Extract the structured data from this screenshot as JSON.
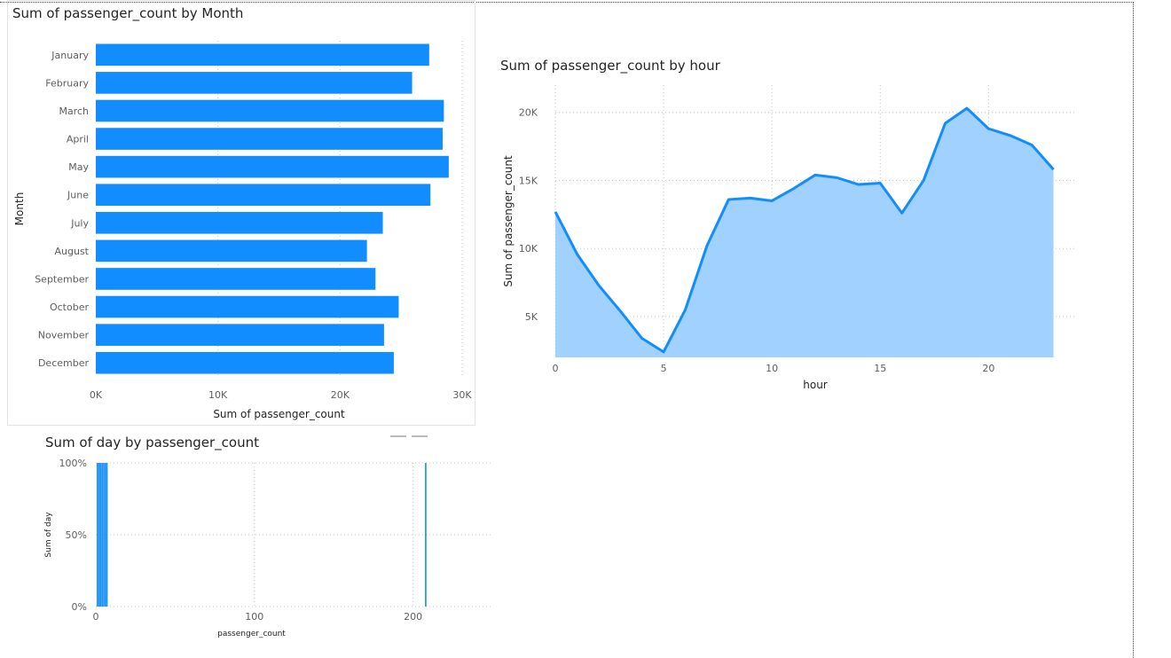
{
  "chart_data": [
    {
      "type": "bar",
      "orientation": "horizontal",
      "title": "Sum of passenger_count by Month",
      "xlabel": "Sum of passenger_count",
      "ylabel": "Month",
      "categories": [
        "January",
        "February",
        "March",
        "April",
        "May",
        "June",
        "July",
        "August",
        "September",
        "October",
        "November",
        "December"
      ],
      "values": [
        27300,
        25900,
        28500,
        28400,
        28900,
        27400,
        23500,
        22200,
        22900,
        24800,
        23600,
        24400
      ],
      "xlim": [
        0,
        30000
      ],
      "xticks": [
        "0K",
        "10K",
        "20K",
        "30K"
      ],
      "color": "#118dff",
      "grid": true
    },
    {
      "type": "area",
      "title": "Sum of passenger_count by hour",
      "xlabel": "hour",
      "ylabel": "Sum of passenger_count",
      "x": [
        0,
        1,
        2,
        3,
        4,
        5,
        6,
        7,
        8,
        9,
        10,
        11,
        12,
        13,
        14,
        15,
        16,
        17,
        18,
        19,
        20,
        21,
        22,
        23
      ],
      "values": [
        12700,
        9600,
        7300,
        5400,
        3400,
        2400,
        5500,
        10200,
        13600,
        13700,
        13500,
        14400,
        15400,
        15200,
        14700,
        14800,
        12600,
        15000,
        19200,
        20300,
        18800,
        18300,
        17600,
        15800
      ],
      "xlim": [
        0,
        24
      ],
      "ylim": [
        2000,
        22000
      ],
      "xticks": [
        "0",
        "5",
        "10",
        "15",
        "20"
      ],
      "yticks": [
        "5K",
        "10K",
        "15K",
        "20K"
      ],
      "color": "#118dff",
      "fill": "#a0d1ff",
      "grid": true
    },
    {
      "type": "bar",
      "title": "Sum of day by passenger_count",
      "xlabel": "passenger_count",
      "ylabel": "Sum of day",
      "x": [
        1,
        2,
        3,
        4,
        5,
        6,
        7,
        208
      ],
      "values": [
        100,
        100,
        100,
        100,
        100,
        100,
        100,
        100
      ],
      "xlim": [
        0,
        250
      ],
      "ylim": [
        0,
        100
      ],
      "xticks": [
        "0",
        "100",
        "200"
      ],
      "yticks": [
        "0%",
        "50%",
        "100%"
      ],
      "color": "#118dff",
      "grid": true
    }
  ]
}
